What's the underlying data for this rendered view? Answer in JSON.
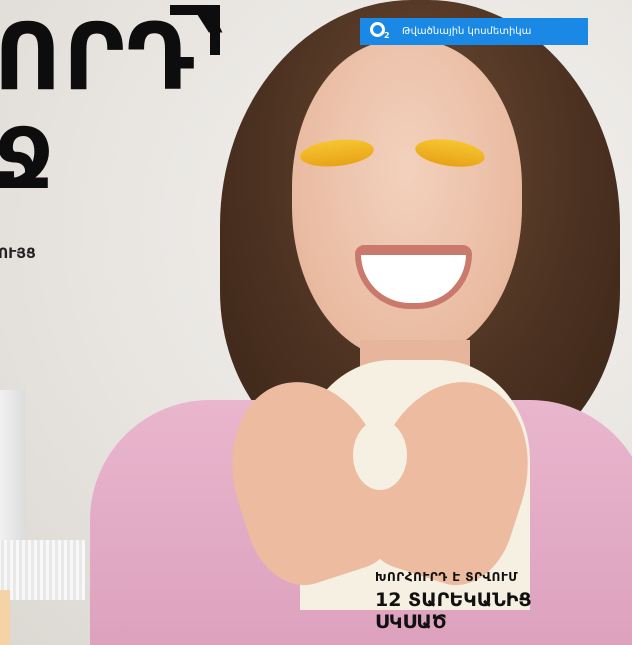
{
  "banner": {
    "brand": "O₂",
    "label": "Թվածնային կոսմետիկա",
    "color": "#1a88e5"
  },
  "headline": {
    "line1": "ՈՐԴ՝",
    "line2": "Ջ",
    "subtitle": "ՈՒՅՑ"
  },
  "caption": {
    "line1": "ԽՈՐՀՈՒՐԴ Է ՏՐՎՈՒՄ",
    "line2": "12 ՏԱՐԵԿԱՆԻՑ",
    "line3": "ՍԿՍԱԾ"
  }
}
